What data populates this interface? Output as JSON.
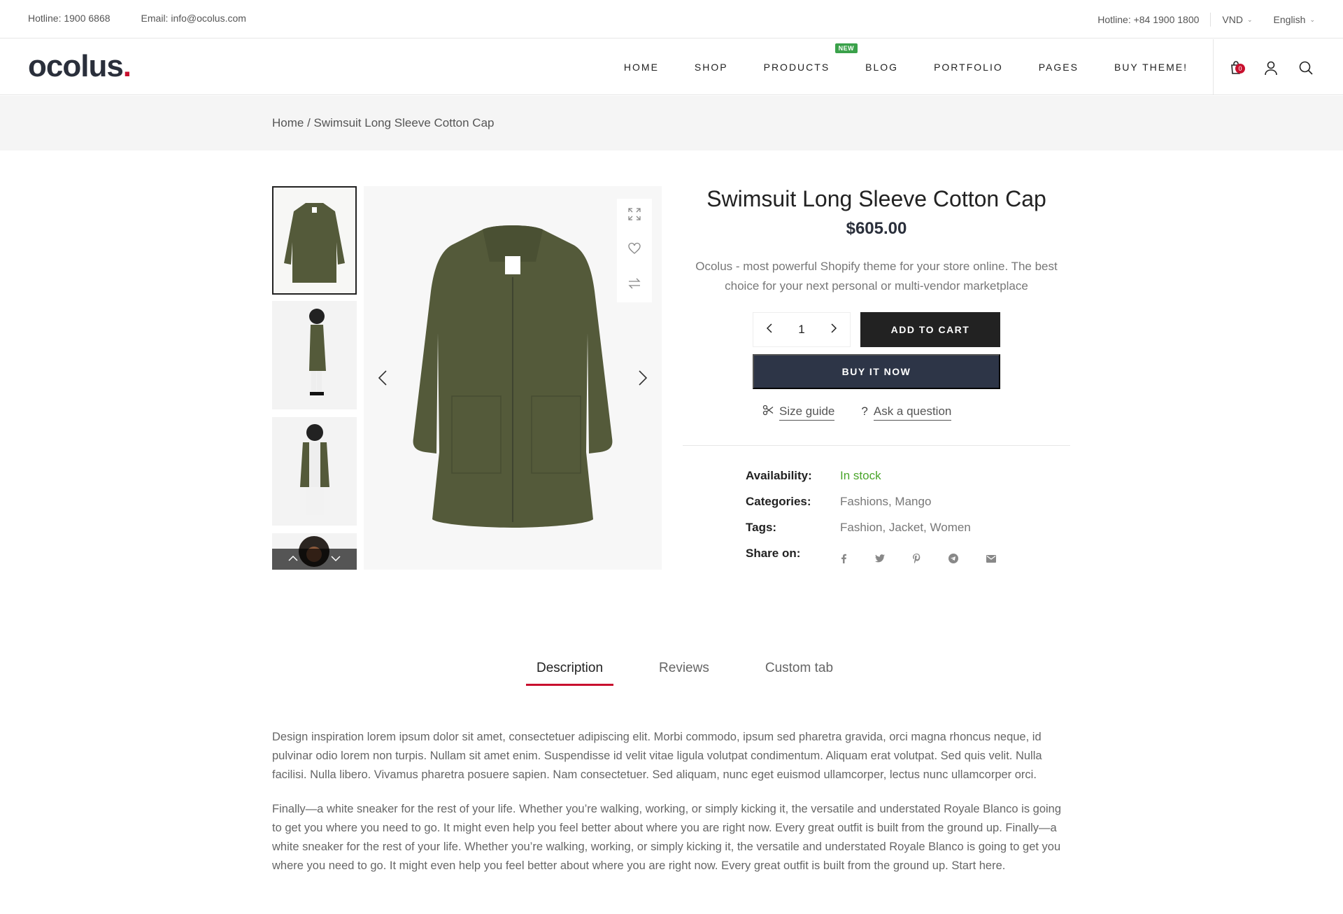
{
  "topbar": {
    "hotline_left": "Hotline: 1900 6868",
    "email": "Email: info@ocolus.com",
    "hotline_right": "Hotline: +84 1900 1800",
    "currency": "VND",
    "language": "English"
  },
  "header": {
    "logo": "ocolus",
    "logo_dot": ".",
    "nav": [
      "HOME",
      "SHOP",
      "PRODUCTS",
      "BLOG",
      "PORTFOLIO",
      "PAGES",
      "BUY THEME!"
    ],
    "new_badge": "NEW",
    "cart_count": "0",
    "icons": [
      "cart-icon",
      "user-icon",
      "search-icon"
    ]
  },
  "breadcrumb": {
    "text": "Home / Swimsuit Long Sleeve Cotton Cap"
  },
  "product": {
    "title": "Swimsuit Long Sleeve Cotton Cap",
    "price": "$605.00",
    "description": "Ocolus - most powerful Shopify theme for your store online. The best choice for your next personal or multi-vendor marketplace",
    "quantity": "1",
    "add_to_cart": "ADD TO CART",
    "buy_now": "BUY IT NOW",
    "size_guide": "Size guide",
    "ask_question": "Ask a question",
    "meta": {
      "availability_label": "Availability:",
      "availability_value": "In stock",
      "categories_label": "Categories:",
      "categories_value": "Fashions, Mango",
      "tags_label": "Tags:",
      "tags_value": "Fashion, Jacket, Women",
      "share_label": "Share on:"
    },
    "share_icons": [
      "facebook-icon",
      "twitter-icon",
      "pinterest-icon",
      "telegram-icon",
      "email-icon"
    ]
  },
  "colors": {
    "accent_red": "#c8102e",
    "stock_green": "#4aa52b",
    "buy_now_bg": "#2d3547",
    "coat": "#545a3a"
  },
  "tabs": [
    "Description",
    "Reviews",
    "Custom tab"
  ],
  "description": {
    "p1": "Design inspiration lorem ipsum dolor sit amet, consectetuer adipiscing elit. Morbi commodo, ipsum sed pharetra gravida, orci magna rhoncus neque, id pulvinar odio lorem non turpis. Nullam sit amet enim. Suspendisse id velit vitae ligula volutpat condimentum. Aliquam erat volutpat. Sed quis velit. Nulla facilisi. Nulla libero. Vivamus pharetra posuere sapien. Nam consectetuer. Sed aliquam, nunc eget euismod ullamcorper, lectus nunc ullamcorper orci.",
    "p2": "Finally—a white sneaker for the rest of your life. Whether you’re walking, working, or simply kicking it, the versatile and understated Royale Blanco is going to get you where you need to go. It might even help you feel better about where you are right now. Every great outfit is built from the ground up. Finally—a white sneaker for the rest of your life. Whether you’re walking, working, or simply kicking it, the versatile and understated Royale Blanco is going to get you where you need to go. It might even help you feel better about where you are right now. Every great outfit is built from the ground up. Start here."
  }
}
